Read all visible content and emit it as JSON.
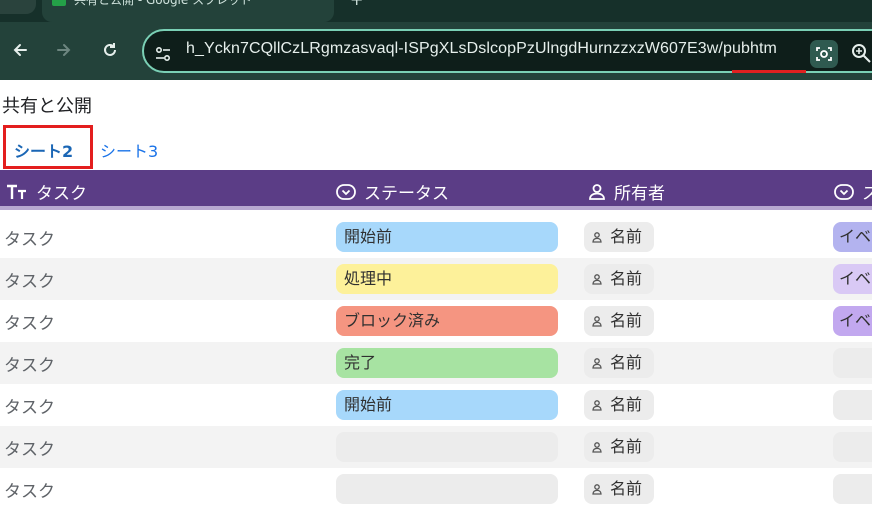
{
  "browser": {
    "tab_title": "共有と公開 - Google スプレッド",
    "tab_close": "✕",
    "new_tab": "+",
    "url": "h_Yckn7CQllCzLRgmzasvaql-ISPgXLsDslcopPzUlngdHurnzzxzW607E3w/pubhtm",
    "url_highlight_color": "#e02020"
  },
  "page": {
    "title": "共有と公開",
    "sheet_tabs": [
      {
        "label": "シート2",
        "active": true
      },
      {
        "label": "シート3",
        "active": false
      }
    ],
    "active_tab_highlight_color": "#e31e1e"
  },
  "table": {
    "header_bg": "#5b3d86",
    "columns": [
      {
        "label": "タスク",
        "icon": "text-type-icon"
      },
      {
        "label": "ステータス",
        "icon": "dropdown-circle-icon"
      },
      {
        "label": "所有者",
        "icon": "person-icon"
      },
      {
        "label": "ス",
        "icon": "dropdown-circle-icon"
      }
    ],
    "rows": [
      {
        "task": "タスク",
        "status": "開始前",
        "status_color": "#a7d8fb",
        "owner": "名前",
        "extra": "イベ",
        "extra_color": "#b3b3ef"
      },
      {
        "task": "タスク",
        "status": "処理中",
        "status_color": "#fdf19a",
        "owner": "名前",
        "extra": "イベ",
        "extra_color": "#d9c9f5"
      },
      {
        "task": "タスク",
        "status": "ブロック済み",
        "status_color": "#f59581",
        "owner": "名前",
        "extra": "イベ",
        "extra_color": "#c2a8ef"
      },
      {
        "task": "タスク",
        "status": "完了",
        "status_color": "#a7e3a2",
        "owner": "名前",
        "extra": "",
        "extra_color": "#ececec"
      },
      {
        "task": "タスク",
        "status": "開始前",
        "status_color": "#a7d8fb",
        "owner": "名前",
        "extra": "",
        "extra_color": "#ececec"
      },
      {
        "task": "タスク",
        "status": "",
        "status_color": "#ececec",
        "owner": "名前",
        "extra": "",
        "extra_color": "#ececec"
      },
      {
        "task": "タスク",
        "status": "",
        "status_color": "#ececec",
        "owner": "名前",
        "extra": "",
        "extra_color": "#ececec"
      }
    ]
  }
}
